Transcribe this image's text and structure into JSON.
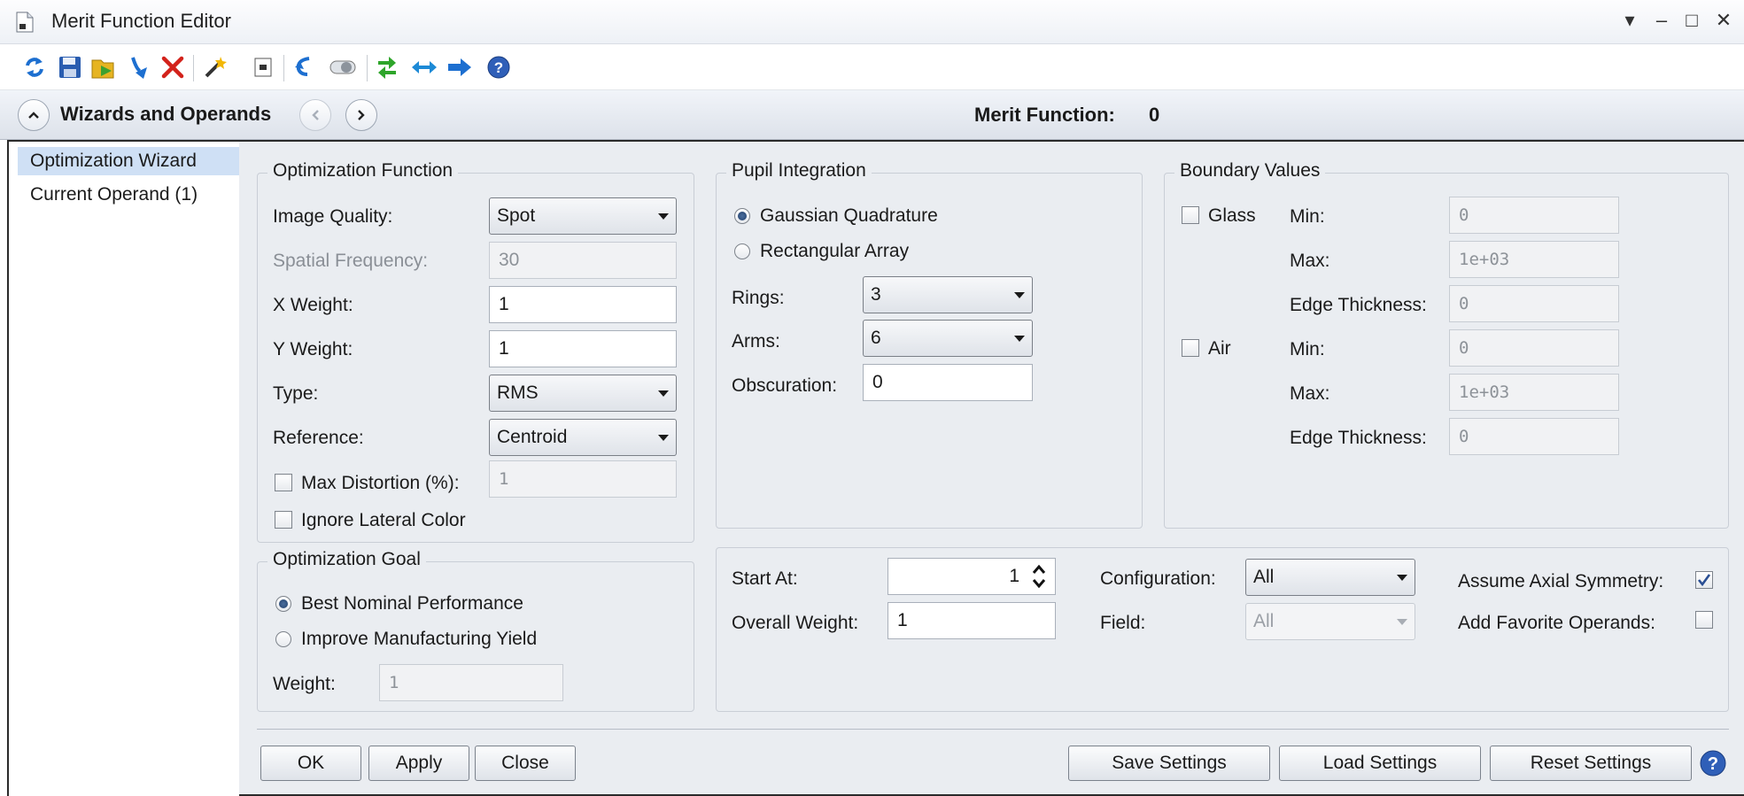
{
  "window": {
    "title": "Merit Function Editor",
    "controls": [
      "▾",
      "–",
      "□",
      "✕"
    ]
  },
  "toolbar": {
    "icons": [
      "refresh-icon",
      "save-icon",
      "load-icon",
      "insert-icon",
      "delete-icon",
      "wizard-icon",
      "window-icon",
      "undo-icon",
      "toggle-icon",
      "sync-icon",
      "expand-icon",
      "arrow-icon",
      "help-icon"
    ]
  },
  "header": {
    "title": "Wizards and Operands",
    "merit_label": "Merit Function:",
    "merit_value": "0"
  },
  "sidebar": {
    "items": [
      {
        "label": "Optimization Wizard",
        "selected": true
      },
      {
        "label": "Current Operand (1)",
        "selected": false
      }
    ]
  },
  "optimization_function": {
    "legend": "Optimization Function",
    "image_quality_label": "Image Quality:",
    "image_quality_value": "Spot",
    "spatial_frequency_label": "Spatial Frequency:",
    "spatial_frequency_value": "30",
    "x_weight_label": "X Weight:",
    "x_weight_value": "1",
    "y_weight_label": "Y Weight:",
    "y_weight_value": "1",
    "type_label": "Type:",
    "type_value": "RMS",
    "reference_label": "Reference:",
    "reference_value": "Centroid",
    "max_distortion_label": "Max Distortion (%):",
    "max_distortion_value": "1",
    "max_distortion_checked": false,
    "ignore_lateral_label": "Ignore Lateral Color",
    "ignore_lateral_checked": false
  },
  "pupil_integration": {
    "legend": "Pupil Integration",
    "gaussian_label": "Gaussian Quadrature",
    "rectangular_label": "Rectangular Array",
    "selected": "gaussian",
    "rings_label": "Rings:",
    "rings_value": "3",
    "arms_label": "Arms:",
    "arms_value": "6",
    "obscuration_label": "Obscuration:",
    "obscuration_value": "0"
  },
  "boundary_values": {
    "legend": "Boundary Values",
    "glass_label": "Glass",
    "glass_checked": false,
    "air_label": "Air",
    "air_checked": false,
    "min_label": "Min:",
    "max_label": "Max:",
    "edge_label": "Edge Thickness:",
    "glass_min": "0",
    "glass_max": "1e+03",
    "glass_edge": "0",
    "air_min": "0",
    "air_max": "1e+03",
    "air_edge": "0"
  },
  "optimization_goal": {
    "legend": "Optimization Goal",
    "best_label": "Best Nominal Performance",
    "improve_label": "Improve Manufacturing Yield",
    "selected": "best",
    "weight_label": "Weight:",
    "weight_value": "1"
  },
  "settings": {
    "start_at_label": "Start At:",
    "start_at_value": "1",
    "overall_weight_label": "Overall Weight:",
    "overall_weight_value": "1",
    "configuration_label": "Configuration:",
    "configuration_value": "All",
    "field_label": "Field:",
    "field_value": "All",
    "axial_symmetry_label": "Assume Axial Symmetry:",
    "axial_symmetry_checked": true,
    "favorite_label": "Add Favorite Operands:",
    "favorite_checked": false
  },
  "buttons": {
    "ok": "OK",
    "apply": "Apply",
    "close": "Close",
    "save_settings": "Save Settings",
    "load_settings": "Load Settings",
    "reset_settings": "Reset Settings"
  },
  "colors": {
    "accent": "#2e6fd6",
    "selected_item": "#cfe0f5",
    "panel": "#eaedf1"
  }
}
